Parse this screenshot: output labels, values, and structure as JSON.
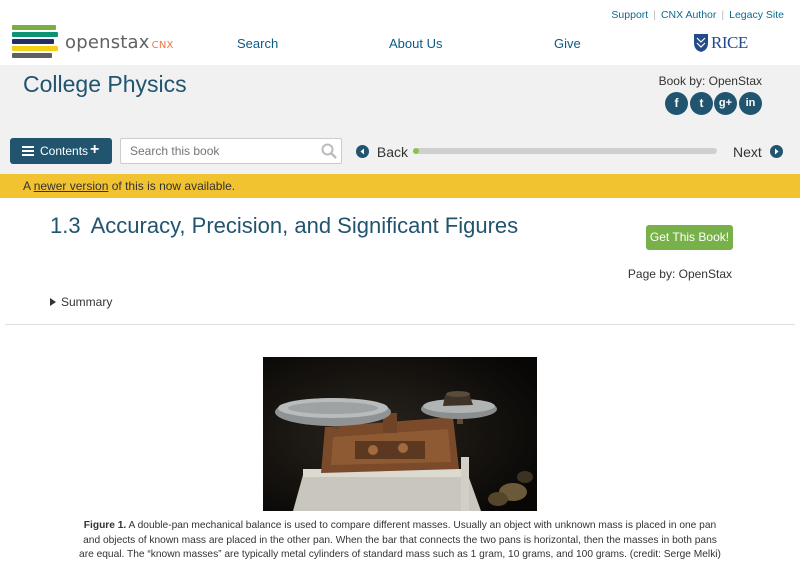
{
  "header": {
    "logo_text": "openstax",
    "logo_suffix": "CNX",
    "utility_links": [
      "Support",
      "CNX Author",
      "Legacy Site"
    ],
    "nav": [
      "Search",
      "About Us",
      "Give"
    ],
    "partner_logo": "RICE"
  },
  "book": {
    "title": "College Physics",
    "author": "Book by: OpenStax",
    "social": [
      {
        "icon": "facebook-icon",
        "glyph": "f"
      },
      {
        "icon": "twitter-icon",
        "glyph": "t"
      },
      {
        "icon": "google-plus-icon",
        "glyph": "g+"
      },
      {
        "icon": "linkedin-icon",
        "glyph": "in"
      }
    ]
  },
  "toolbar": {
    "contents_label": "Contents",
    "search_placeholder": "Search this book",
    "back_label": "Back",
    "next_label": "Next",
    "progress_fraction": 0.02
  },
  "notice": {
    "prefix": "A ",
    "link": "newer version",
    "suffix": " of this is now available."
  },
  "page": {
    "number": "1.3",
    "title": "Accuracy, Precision, and Significant Figures",
    "get_book": "Get This Book!",
    "page_by": "Page by: OpenStax",
    "summary": "Summary"
  },
  "figure": {
    "label": "Figure 1.",
    "caption": "A double-pan mechanical balance is used to compare different masses. Usually an object with unknown mass is placed in one pan and objects of known mass are placed in the other pan. When the bar that connects the two pans is horizontal, then the masses in both pans are equal. The “known masses” are typically metal cylinders of standard mass such as 1 gram, 10 grams, and 100 grams. (credit: Serge Melki)"
  },
  "colors": {
    "brand_blue": "#21546f",
    "notice_yellow": "#f2c331",
    "button_green": "#78b04a",
    "progress_green": "#8bc34a"
  }
}
